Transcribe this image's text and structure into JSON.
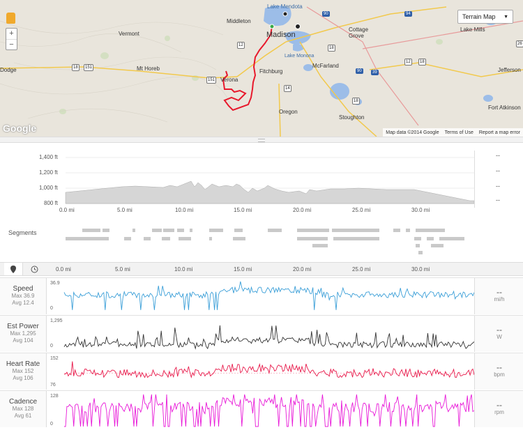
{
  "map": {
    "type_button": "Terrain Map",
    "google_logo": "Google",
    "attribution": [
      "Map data ©2014 Google",
      "Terms of Use",
      "Report a map error"
    ],
    "zoom_in": "+",
    "zoom_out": "−",
    "place_labels": [
      "Middleton",
      "Madison",
      "Cottage Grove",
      "Lake Mills",
      "Vermont",
      "Mt Horeb",
      "Verona",
      "Fitchburg",
      "McFarland",
      "Lake Monona",
      "Oregon",
      "Stoughton",
      "Fort Atkinson",
      "Jefferson",
      "Lake Mendota",
      "Dodge"
    ],
    "shields": [
      "18",
      "151",
      "151",
      "12",
      "14",
      "18",
      "12",
      "18",
      "18",
      "26",
      "90",
      "94",
      "90",
      "39"
    ],
    "colors": {
      "route": "#e8192c",
      "water": "#9cbde8",
      "terrain": "#e9e5dc"
    }
  },
  "elevation": {
    "y_ticks": [
      "1,400 ft",
      "1,200 ft",
      "1,000 ft",
      "800 ft"
    ],
    "x_ticks": [
      "0.0 mi",
      "5.0 mi",
      "10.0 mi",
      "15.0 mi",
      "20.0 mi",
      "25.0 mi",
      "30.0 mi"
    ],
    "side_values": [
      "--",
      "--",
      "--",
      "--"
    ]
  },
  "segments": {
    "label": "Segments"
  },
  "toolbar": {
    "x_ticks": [
      "0.0 mi",
      "5.0 mi",
      "10.0 mi",
      "15.0 mi",
      "20.0 mi",
      "25.0 mi",
      "30.0 mi"
    ],
    "icons": [
      "map-pin-icon",
      "clock-icon"
    ]
  },
  "streams": [
    {
      "name": "Speed",
      "max": "Max 36.9",
      "avg": "Avg 12.4",
      "ytop": "36.9",
      "ybot": "0",
      "value": "--",
      "unit": "mi/h",
      "color": "#3b9fd8"
    },
    {
      "name": "Est Power",
      "max": "Max 1,295",
      "avg": "Avg 104",
      "ytop": "1,295",
      "ybot": "0",
      "value": "--",
      "unit": "W",
      "color": "#333333"
    },
    {
      "name": "Heart Rate",
      "max": "Max 152",
      "avg": "Avg 106",
      "ytop": "152",
      "ybot": "76",
      "value": "--",
      "unit": "bpm",
      "color": "#e8194a"
    },
    {
      "name": "Cadence",
      "max": "Max 128",
      "avg": "Avg 61",
      "ytop": "128",
      "ybot": "0",
      "value": "--",
      "unit": "rpm",
      "color": "#e818d8"
    }
  ]
}
